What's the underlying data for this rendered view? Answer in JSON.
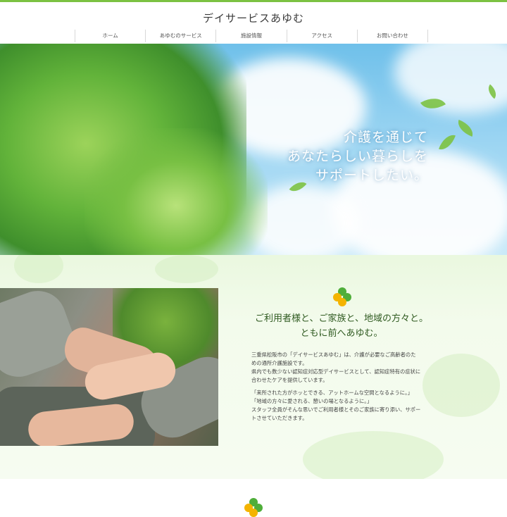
{
  "site": {
    "title": "デイサービスあゆむ"
  },
  "nav": {
    "items": [
      {
        "label": "ホーム"
      },
      {
        "label": "あゆむのサービス"
      },
      {
        "label": "施設情報"
      },
      {
        "label": "アクセス"
      },
      {
        "label": "お問い合わせ"
      }
    ]
  },
  "hero": {
    "lines": [
      "介護を通じて",
      "あなたらしい暮らしを",
      "サポートしたい。"
    ]
  },
  "about": {
    "title_lines": [
      "ご利用者様と、ご家族と、地域の方々と。",
      "ともに前へあゆむ。"
    ],
    "paragraph1": [
      "三重県松阪市の「デイサービスあゆむ」は、介護が必要なご高齢者のた",
      "めの通所介護施設です。",
      "県内でも数少ない認知症対応型デイサービスとして、認知症特有の症状に",
      "合わせたケアを提供しています。"
    ],
    "paragraph2": [
      "「来所された方がホッとできる、アットホームな空間となるように。」",
      "「地域の方々に愛される、憩いの場となるように。」",
      "スタッフ全員がそんな思いでご利用者様とそのご家族に寄り添い、サポー",
      "トさせていただきます。"
    ]
  },
  "colors": {
    "brand_green": "#7cc242",
    "clover_green": "#4fae3a",
    "clover_yellow": "#f4b400"
  },
  "icons": {
    "clover": "clover-icon"
  }
}
